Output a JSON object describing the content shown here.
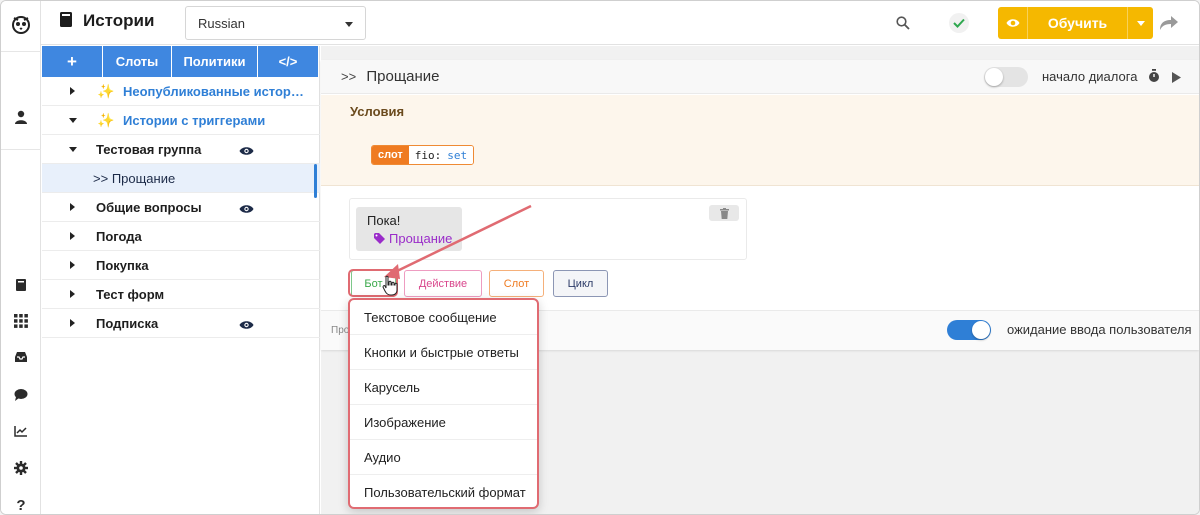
{
  "app": {
    "title": "Истории"
  },
  "language": {
    "selected": "Russian"
  },
  "toolbar": {
    "train_label": "Обучить"
  },
  "sidebar": {
    "tabs": [
      {
        "label": "+"
      },
      {
        "label": "Слоты"
      },
      {
        "label": "Политики"
      },
      {
        "label": "</>"
      }
    ],
    "items": [
      {
        "label": "Неопубликованные истор…",
        "expanded": false
      },
      {
        "label": "Истории с триггерами",
        "expanded": true
      },
      {
        "label": "Тестовая группа",
        "expanded": true
      },
      {
        "label": "Прощание",
        "prefix": ">>"
      },
      {
        "label": "Общие вопросы",
        "expanded": false
      },
      {
        "label": "Погода",
        "expanded": false
      },
      {
        "label": "Покупка",
        "expanded": false
      },
      {
        "label": "Тест форм",
        "expanded": false
      },
      {
        "label": "Подписка",
        "expanded": false
      }
    ]
  },
  "story": {
    "chevron": ">>",
    "title": "Прощание",
    "start_toggle_label": "начало диалога",
    "conditions_title": "Условия",
    "slot_condition": {
      "tag": "слот",
      "name": "fio:",
      "value": "set"
    },
    "bot_message": {
      "text": "Пока!",
      "tag": "Прощание"
    },
    "add_buttons": [
      {
        "label": "Бот",
        "color": "#3aa84a",
        "border": "#7ec88a"
      },
      {
        "label": "Действие",
        "color": "#d9468c",
        "border": "#ee9cc1"
      },
      {
        "label": "Слот",
        "color": "#ef7b21",
        "border": "#f5b07a"
      },
      {
        "label": "Цикл",
        "color": "#2b3a67",
        "border": "#8c96b4"
      }
    ],
    "footer_prefix": "Про",
    "wait_input_label": "ожидание ввода пользователя"
  },
  "dropdown": {
    "items": [
      {
        "label": "Текстовое сообщение"
      },
      {
        "label": "Кнопки и быстрые ответы"
      },
      {
        "label": "Карусель"
      },
      {
        "label": "Изображение"
      },
      {
        "label": "Аудио"
      },
      {
        "label": "Пользовательский формат"
      }
    ]
  },
  "colors": {
    "accent_blue": "#3f87e0",
    "train_yellow": "#f5b800",
    "highlight_red": "#e06b72",
    "toggle_on": "#2f7fd6"
  },
  "icons": {
    "rail": [
      "owl-logo-icon",
      "user-icon",
      "book-icon",
      "grid-icon",
      "inbox-icon",
      "chat-icon",
      "chart-icon",
      "gear-icon",
      "help-icon"
    ],
    "topbar": [
      "search-icon",
      "check-icon",
      "eye-icon",
      "redo-icon"
    ]
  }
}
